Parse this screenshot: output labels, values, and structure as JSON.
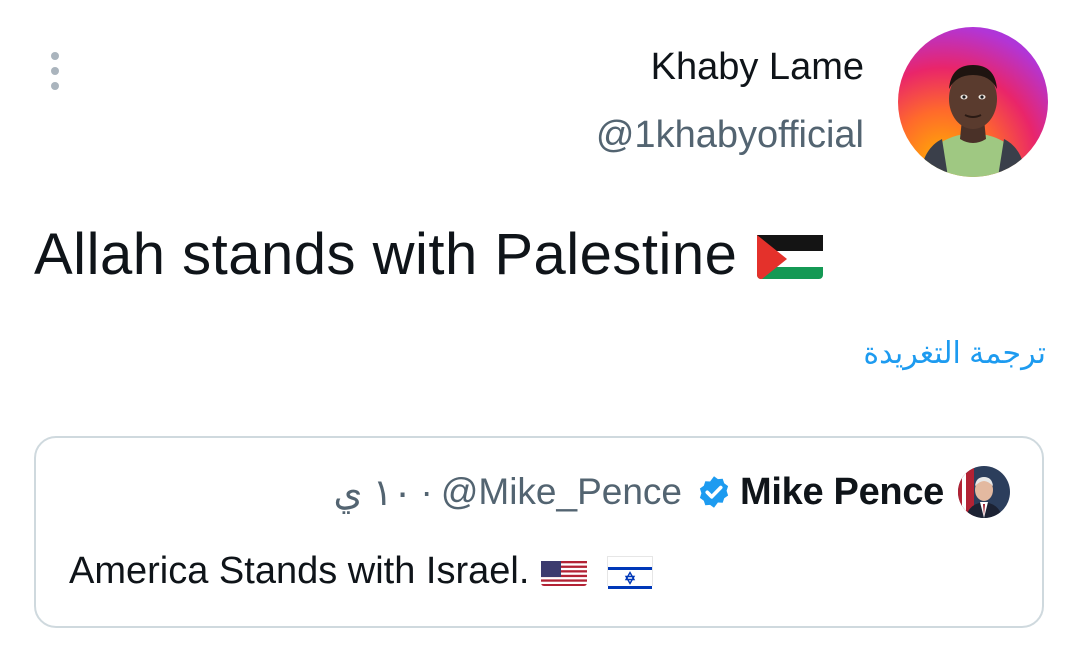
{
  "tweet": {
    "author_name": "Khaby Lame",
    "author_handle": "@1khabyofficial",
    "text": "Allah stands with Palestine",
    "translate_label": "ترجمة التغريدة",
    "flag_icon": "palestine-flag-icon"
  },
  "quoted_tweet": {
    "author_name": "Mike Pence",
    "author_handle": "@Mike_Pence",
    "separator": "·",
    "time": "١٠ ي",
    "text": "America Stands with Israel.",
    "verified_icon": "verified-badge-icon",
    "flags": [
      "us-flag-icon",
      "israel-flag-icon"
    ]
  },
  "colors": {
    "link": "#1d9bf0",
    "secondary_text": "#536471",
    "border": "#cfd9de"
  }
}
